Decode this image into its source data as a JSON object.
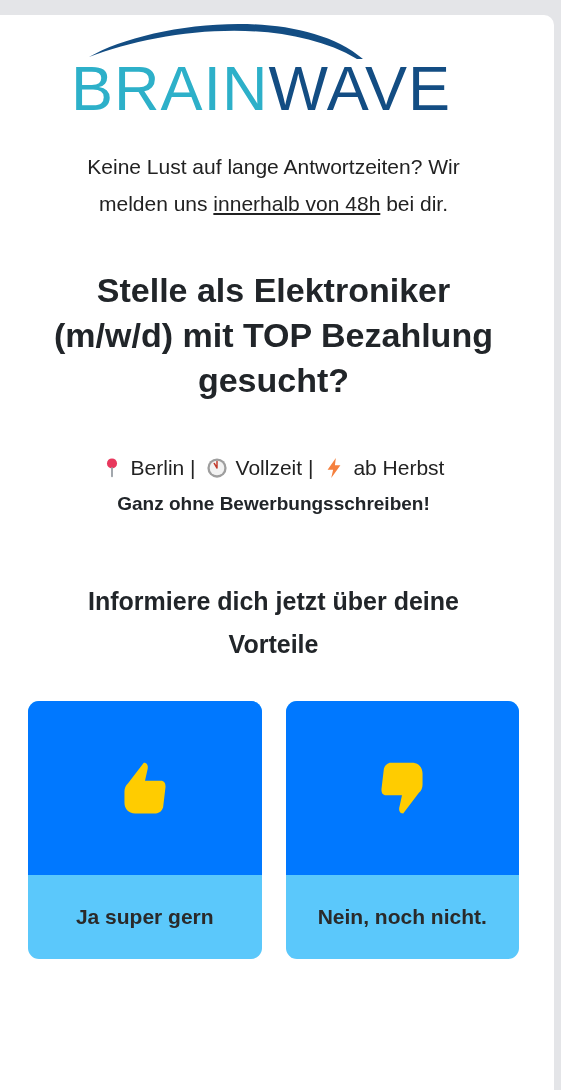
{
  "logo": {
    "part_1": "BRAIN",
    "part_2": "WAVE"
  },
  "intro": {
    "before": "Keine Lust auf lange Antwortzeiten? Wir melden uns ",
    "link": "innerhalb von 48h",
    "after": " bei dir."
  },
  "headline": "Stelle als Elektroniker (m/w/d) mit TOP Bezahlung gesucht?",
  "facts": [
    {
      "kind": "pin",
      "text": "Berlin |"
    },
    {
      "kind": "clock",
      "text": "Vollzeit |"
    },
    {
      "kind": "bolt",
      "text": "ab Herbst"
    }
  ],
  "tagline": "Ganz ohne Bewerbungsschreiben!",
  "question": "Informiere dich jetzt über deine Vorteile",
  "answers": [
    {
      "kind": "up",
      "label": "Ja super gern"
    },
    {
      "kind": "down",
      "label": "Nein, noch nicht."
    }
  ]
}
